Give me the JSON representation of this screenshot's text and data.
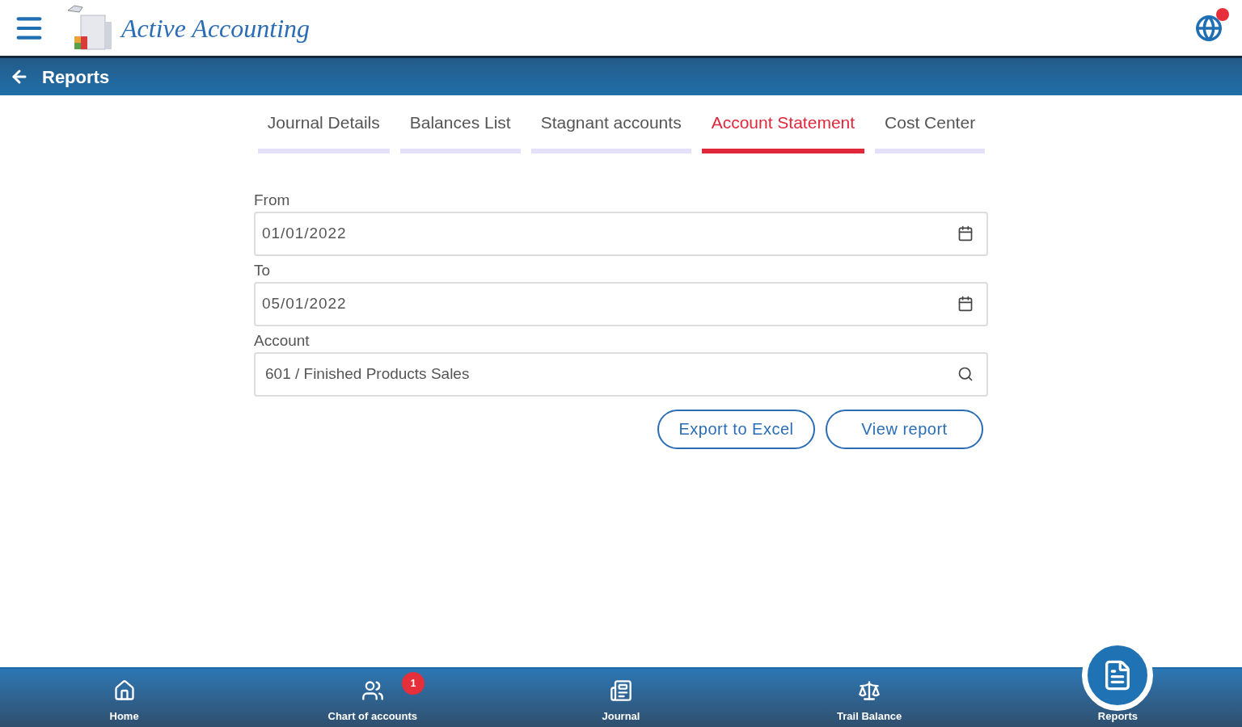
{
  "app": {
    "title": "Active Accounting"
  },
  "page": {
    "title": "Reports"
  },
  "tabs": [
    {
      "label": "Journal Details",
      "selected": false
    },
    {
      "label": "Balances List",
      "selected": false
    },
    {
      "label": "Stagnant accounts",
      "selected": false
    },
    {
      "label": "Account Statement",
      "selected": true
    },
    {
      "label": "Cost Center",
      "selected": false
    }
  ],
  "form": {
    "fields": [
      {
        "kind": "date",
        "label": "From",
        "value": "01/01/2022"
      },
      {
        "kind": "date",
        "label": "To",
        "value": "05/01/2022"
      },
      {
        "kind": "search",
        "label": "Account",
        "value": "601 / Finished Products Sales"
      }
    ],
    "buttons": [
      "Export to Excel",
      "View report"
    ]
  },
  "bottom_nav": [
    {
      "kind": "home",
      "label": "Home",
      "selected": false
    },
    {
      "kind": "accounts",
      "label": "Chart of accounts",
      "selected": false,
      "badge": "1"
    },
    {
      "kind": "journal",
      "label": "Journal",
      "selected": false
    },
    {
      "kind": "balance",
      "label": "Trail Balance",
      "selected": false
    },
    {
      "kind": "reports",
      "label": "Reports",
      "selected": true
    }
  ]
}
